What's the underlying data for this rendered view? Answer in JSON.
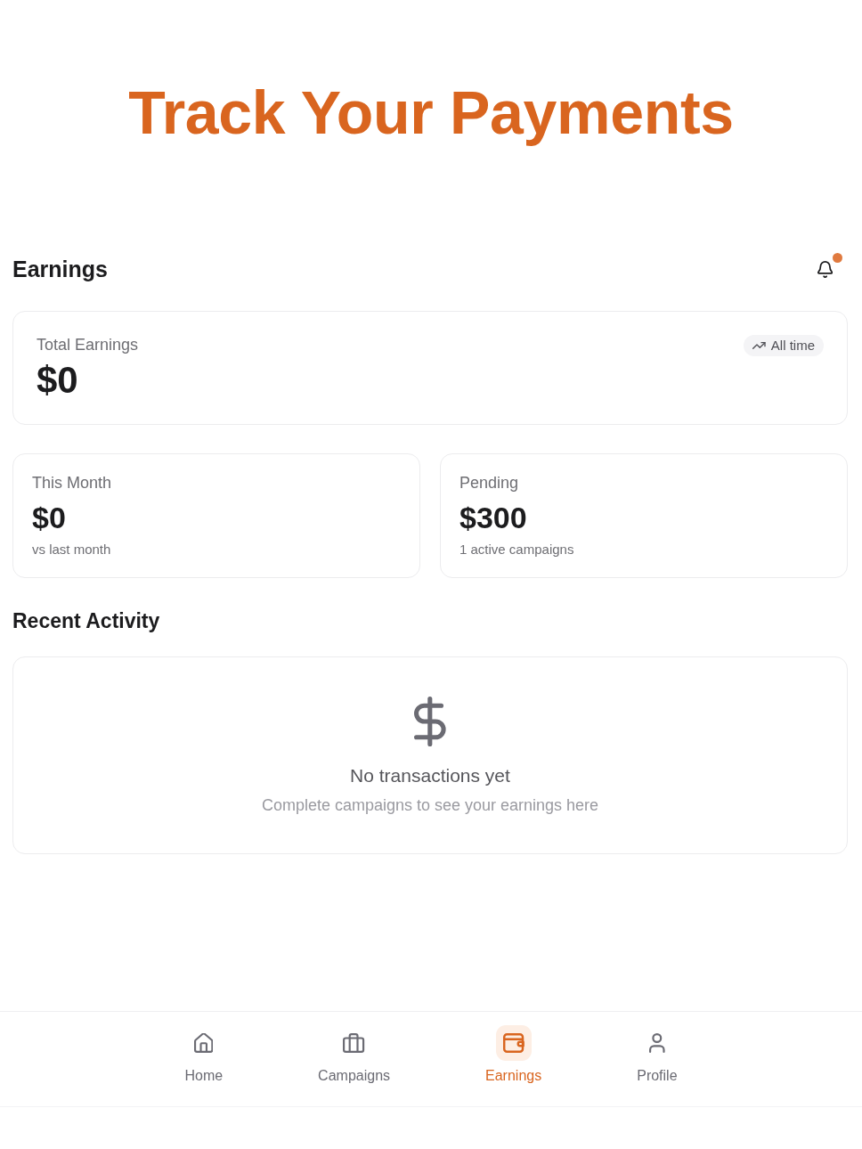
{
  "headline": "Track Your Payments",
  "header": {
    "title": "Earnings",
    "has_unread": true
  },
  "total_card": {
    "label": "Total Earnings",
    "amount": "$0",
    "period": "All time"
  },
  "stat_cards": [
    {
      "label": "This Month",
      "amount": "$0",
      "caption": "vs last month"
    },
    {
      "label": "Pending",
      "amount": "$300",
      "caption": "1 active campaigns"
    }
  ],
  "recent_activity": {
    "title": "Recent Activity",
    "empty_title": "No transactions yet",
    "empty_message": "Complete campaigns to see your earnings here"
  },
  "nav": [
    {
      "kind": "home",
      "label": "Home",
      "selected": false
    },
    {
      "kind": "campaigns",
      "label": "Campaigns",
      "selected": false
    },
    {
      "kind": "earnings",
      "label": "Earnings",
      "selected": true
    },
    {
      "kind": "profile",
      "label": "Profile",
      "selected": false
    }
  ]
}
